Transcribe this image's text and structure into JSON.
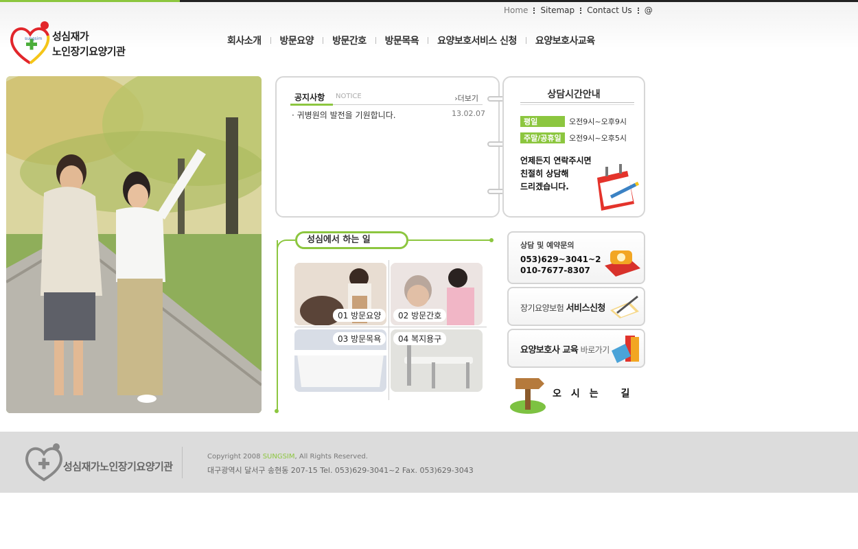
{
  "header": {
    "util": [
      "Home",
      "Sitemap",
      "Contact Us",
      "@"
    ],
    "logo": {
      "line1": "성심재가",
      "line2": "노인장기요양기관",
      "badge": "sungsim"
    },
    "nav": [
      "회사소개",
      "방문요양",
      "방문간호",
      "방문목욕",
      "요양보호서비스 신청",
      "요양보호사교육"
    ]
  },
  "notice": {
    "title": "공지사항",
    "subtitle": "NOTICE",
    "more": "더보기",
    "items": [
      {
        "title": "· 귀병원의 발전을 기원합니다.",
        "date": "13.02.07"
      }
    ]
  },
  "hours": {
    "title": "상담시간안내",
    "rows": [
      {
        "label": "평일",
        "value": "오전9시~오후9시"
      },
      {
        "label": "주말/공휴일",
        "value": "오전9시~오후5시"
      }
    ],
    "message": [
      "언제든지 연락주시면",
      "친절히 상담해",
      "드리겠습니다."
    ]
  },
  "works": {
    "title": "성심에서 하는 일",
    "tiles": [
      "01 방문요양",
      "02 방문간호",
      "03 방문목욕",
      "04 복지용구"
    ]
  },
  "side": {
    "consult_title": "상담 및 예약문의",
    "phone1": "053)629~3041~2",
    "phone2": "010-7677-8307",
    "service_prefix": "장기요양보험",
    "service_main": "서비스신청",
    "edu_main": "요양보호사 교육",
    "edu_suffix": "바로가기",
    "directions": "오시는 길"
  },
  "footer": {
    "logo_text": "성심재가노인장기요양기관",
    "copyright_pre": "Copyright 2008",
    "copyright_brand": "SUNGSIM",
    "copyright_post": ", All Rights Reserved.",
    "address": "대구광역시 달서구 송현동 207-15   Tel. 053)629-3041~2  Fax. 053)629-3043"
  },
  "colors": {
    "accent": "#8cc63f",
    "logo_red": "#e2262b",
    "logo_yellow": "#f5c518"
  }
}
